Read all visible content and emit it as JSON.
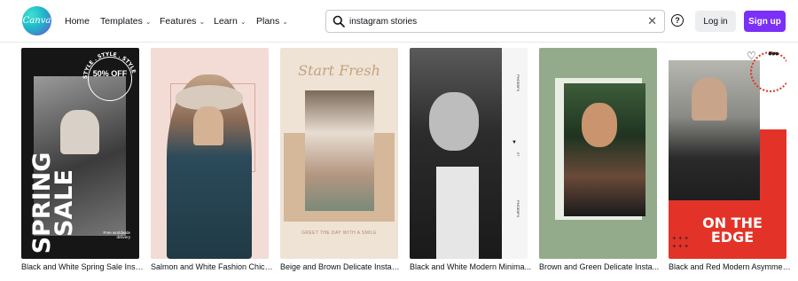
{
  "header": {
    "logo_text": "Canva",
    "nav": [
      {
        "label": "Home",
        "has_dropdown": false
      },
      {
        "label": "Templates",
        "has_dropdown": true
      },
      {
        "label": "Features",
        "has_dropdown": true
      },
      {
        "label": "Learn",
        "has_dropdown": true
      },
      {
        "label": "Plans",
        "has_dropdown": true
      }
    ],
    "search": {
      "value": "instagram stories",
      "icon": "search-icon",
      "clear_icon": "close-icon"
    },
    "help_icon": "?",
    "login_label": "Log in",
    "signup_label": "Sign up"
  },
  "colors": {
    "accent": "#7b2ff7",
    "logo": "#1fb8c9"
  },
  "templates": [
    {
      "caption": "Black and White Spring Sale Inst...",
      "art": {
        "headline": "SPRING SALE",
        "promo": "50% OFF",
        "promo_ring": "STYLE . STYLE . STYLE",
        "footer": "Free worldwide delivery"
      }
    },
    {
      "caption": "Salmon and White Fashion Chic I..."
    },
    {
      "caption": "Beige and Brown Delicate Instag...",
      "art": {
        "script": "Start Fresh",
        "tagline": "GREET THE DAY WITH A SMILE"
      }
    },
    {
      "caption": "Black and White Modern Minima...",
      "art": {
        "side_top": "PHOEBFX",
        "arrow": "▼",
        "side_mid": "07",
        "side_bottom": "PHOEBFX"
      }
    },
    {
      "caption": "Brown and Green Delicate Insta..."
    },
    {
      "caption": "Black and Red Modern Asymmet...",
      "art": {
        "headline": "ON THE EDGE",
        "heart_icon": "♡",
        "more_icon": "•••"
      }
    }
  ]
}
